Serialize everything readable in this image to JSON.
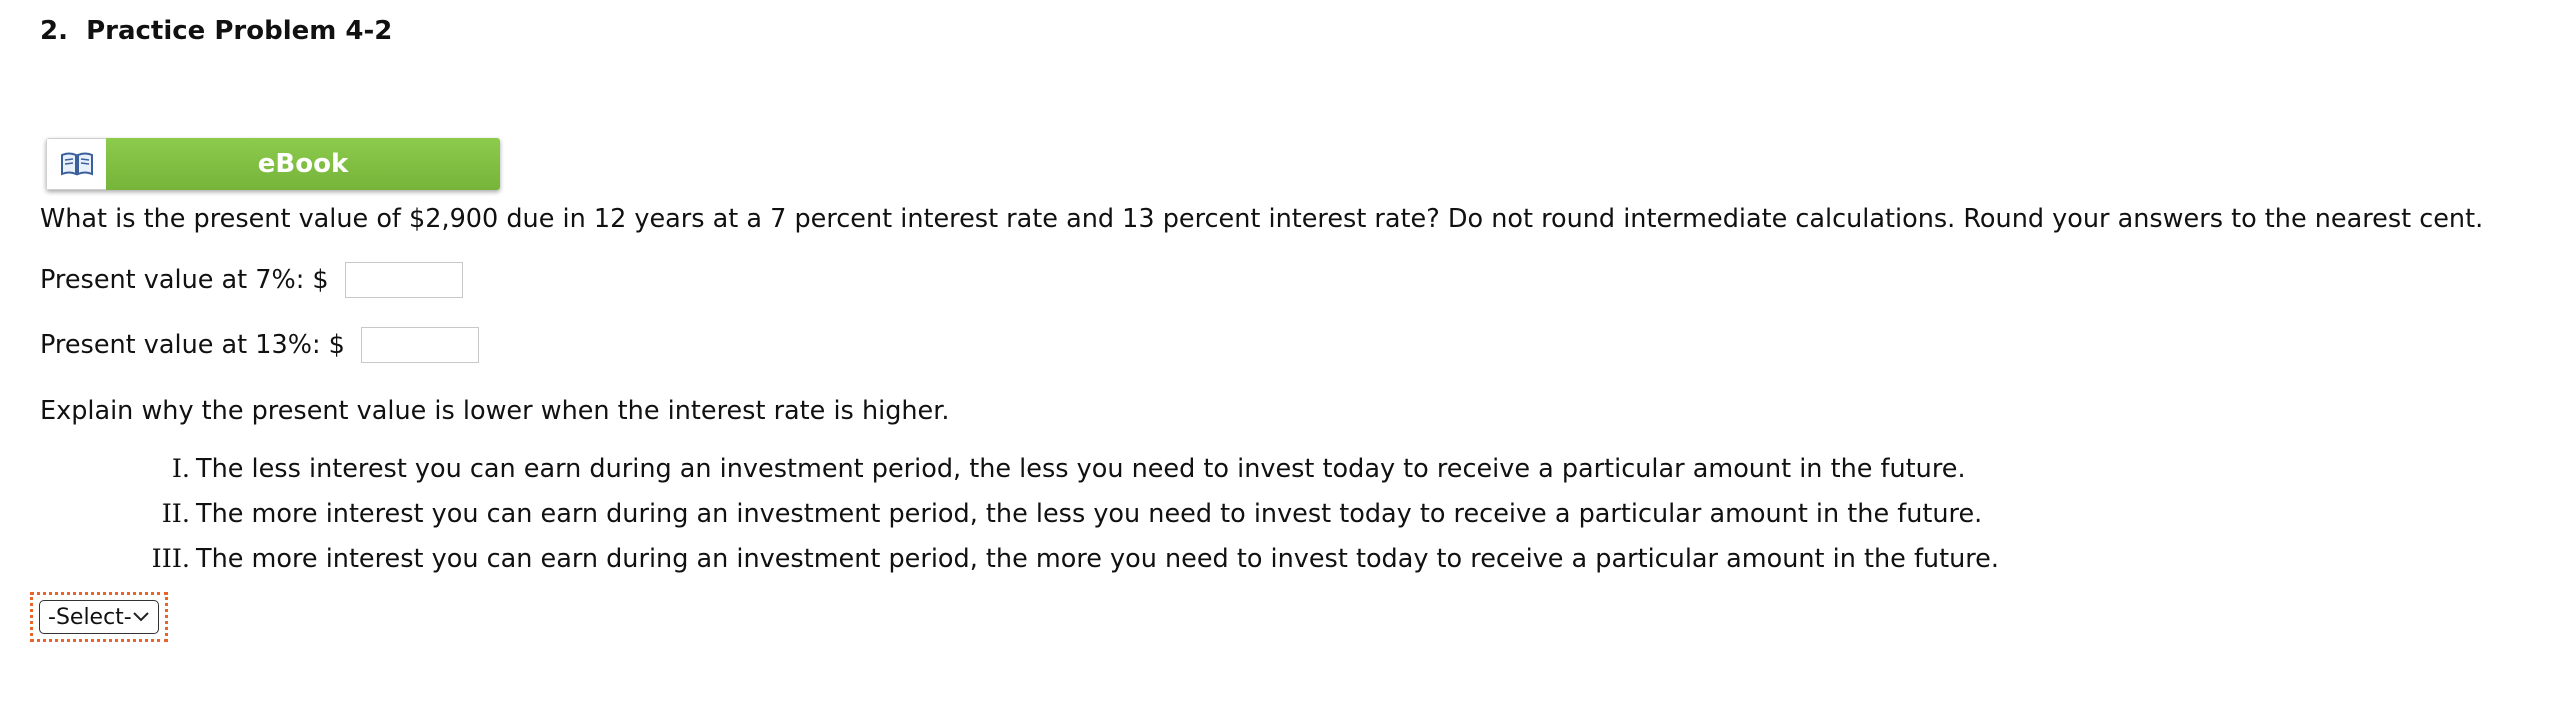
{
  "problem": {
    "number": "2.",
    "title": "Practice Problem 4-2"
  },
  "ebook": {
    "label": "eBook",
    "icon": "open-book-icon"
  },
  "question": {
    "text": "What is the present value of $2,900 due in 12 years at a 7 percent interest rate and 13 percent interest rate? Do not round intermediate calculations. Round your answers to the nearest cent."
  },
  "answers": {
    "pv7_label": "Present value at 7%: $",
    "pv7_value": "",
    "pv13_label": "Present value at 13%: $",
    "pv13_value": ""
  },
  "explain": {
    "prompt": "Explain why the present value is lower when the interest rate is higher.",
    "options": [
      {
        "num": "I.",
        "text": "The less interest you can earn during an investment period, the less you need to invest today to receive a particular amount in the future."
      },
      {
        "num": "II.",
        "text": "The more interest you can earn during an investment period, the less you need to invest today to receive a particular amount in the future."
      },
      {
        "num": "III.",
        "text": "The more interest you can earn during an investment period, the more you need to invest today to receive a particular amount in the future."
      }
    ],
    "select_value": "-Select-"
  },
  "colors": {
    "ebook_green": "#82c045",
    "focus_outline": "#e8642a"
  }
}
